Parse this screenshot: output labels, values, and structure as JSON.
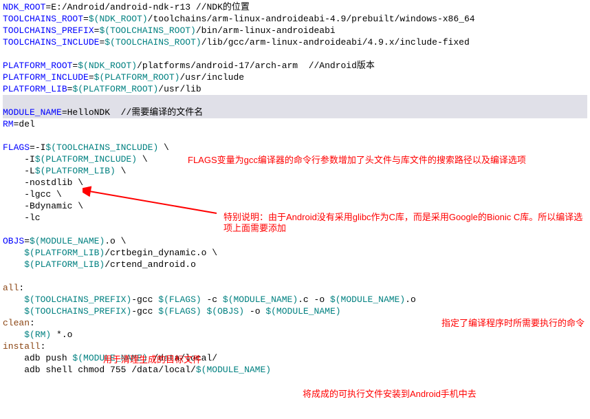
{
  "lines": {
    "l1a": "NDK_ROOT",
    "l1b": "=E:/Android/android-ndk-r13 //NDK的位置",
    "l2a": "TOOLCHAINS_ROOT",
    "l2b": "=",
    "l2c": "$(NDK_ROOT)",
    "l2d": "/toolchains/arm-linux-androideabi-4.9/prebuilt/windows-x86_64",
    "l3a": "TOOLCHAINS_PREFIX",
    "l3b": "=",
    "l3c": "$(TOOLCHAINS_ROOT)",
    "l3d": "/bin/arm-linux-androideabi",
    "l4a": "TOOLCHAINS_INCLUDE",
    "l4b": "=",
    "l4c": "$(TOOLCHAINS_ROOT)",
    "l4d": "/lib/gcc/arm-linux-androideabi/4.9.x/include-fixed",
    "l5": " ",
    "l6a": "PLATFORM_ROOT",
    "l6b": "=",
    "l6c": "$(NDK_ROOT)",
    "l6d": "/platforms/android-17/arch-arm  //Android版本",
    "l7a": "PLATFORM_INCLUDE",
    "l7b": "=",
    "l7c": "$(PLATFORM_ROOT)",
    "l7d": "/usr/include",
    "l8a": "PLATFORM_LIB",
    "l8b": "=",
    "l8c": "$(PLATFORM_ROOT)",
    "l8d": "/usr/lib",
    "l9": " ",
    "l10a": "MODULE_NAME",
    "l10b": "=HelloNDK  //需要编译的文件名",
    "l11a": "RM",
    "l11b": "=del",
    "l12": " ",
    "l13a": "FLAGS",
    "l13b": "=-I",
    "l13c": "$(TOOLCHAINS_INCLUDE)",
    "l13d": " \\",
    "l14a": "    -I",
    "l14b": "$(PLATFORM_INCLUDE)",
    "l14c": " \\",
    "l15a": "    -L",
    "l15b": "$(PLATFORM_LIB)",
    "l15c": " \\",
    "l16": "    -nostdlib \\",
    "l17": "    -lgcc \\",
    "l18": "    -Bdynamic \\",
    "l19": "    -lc",
    "l20": " ",
    "l21a": "OBJS",
    "l21b": "=",
    "l21c": "$(MODULE_NAME)",
    "l21d": ".o \\",
    "l22a": "    ",
    "l22b": "$(PLATFORM_LIB)",
    "l22c": "/crtbegin_dynamic.o \\",
    "l23a": "    ",
    "l23b": "$(PLATFORM_LIB)",
    "l23c": "/crtend_android.o",
    "l24": " ",
    "l25a": "all",
    "l25b": ":",
    "l26a": "    ",
    "l26b": "$(TOOLCHAINS_PREFIX)",
    "l26c": "-gcc ",
    "l26d": "$(FLAGS)",
    "l26e": " -c ",
    "l26f": "$(MODULE_NAME)",
    "l26g": ".c -o ",
    "l26h": "$(MODULE_NAME)",
    "l26i": ".o",
    "l27a": "    ",
    "l27b": "$(TOOLCHAINS_PREFIX)",
    "l27c": "-gcc ",
    "l27d": "$(FLAGS)",
    "l27e": " ",
    "l27f": "$(OBJS)",
    "l27g": " -o ",
    "l27h": "$(MODULE_NAME)",
    "l28a": "clean",
    "l28b": ":",
    "l29a": "    ",
    "l29b": "$(RM)",
    "l29c": " *.o",
    "l30a": "install",
    "l30b": ":",
    "l31a": "    adb push ",
    "l31b": "$(MODULE_NAME)",
    "l31c": " /data/local/",
    "l32a": "    adb shell chmod 755 /data/local/",
    "l32b": "$(MODULE_NAME)"
  },
  "annotations": {
    "a1": "FLAGS变量为gcc编译器的命令行参数增加了头文件与库文件的搜索路径以及编译选项",
    "a2": "特别说明：由于Android没有采用glibc作为C库，而是采用Google的Bionic C库。所以编译选项上面需要添加",
    "a3": "指定了编译程序时所需要执行的命令",
    "a4": "用于清理生成的目标文件",
    "a5": "将成成的可执行文件安装到Android手机中去"
  }
}
